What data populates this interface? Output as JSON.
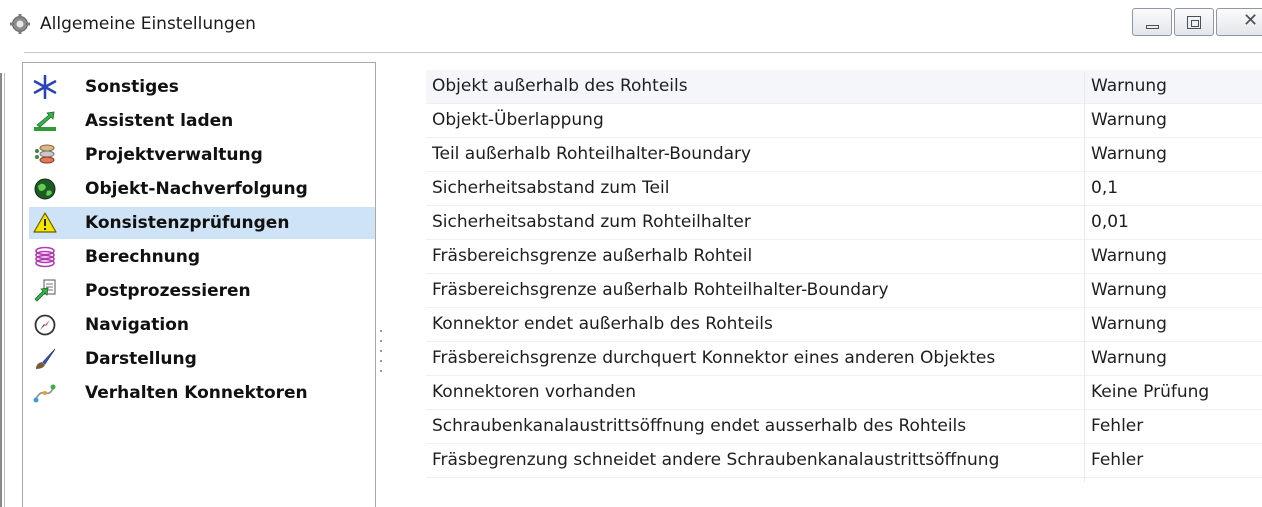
{
  "window": {
    "title": "Allgemeine Einstellungen",
    "icon": "gear-icon",
    "controls": [
      "minimize-icon",
      "maximize-icon",
      "close-icon"
    ]
  },
  "sidebar": {
    "selected_index": 4,
    "selected_color": "#cfe3f7",
    "items": [
      {
        "label": "Sonstiges",
        "icon": "asterisk-icon"
      },
      {
        "label": "Assistent laden",
        "icon": "load-arrow-icon"
      },
      {
        "label": "Projektverwaltung",
        "icon": "stack-icon"
      },
      {
        "label": "Objekt-Nachverfolgung",
        "icon": "globe-icon"
      },
      {
        "label": "Konsistenzprüfungen",
        "icon": "warning-icon"
      },
      {
        "label": "Berechnung",
        "icon": "spiral-icon"
      },
      {
        "label": "Postprozessieren",
        "icon": "export-icon"
      },
      {
        "label": "Navigation",
        "icon": "compass-icon"
      },
      {
        "label": "Darstellung",
        "icon": "brush-icon"
      },
      {
        "label": "Verhalten Konnektoren",
        "icon": "connector-icon"
      }
    ]
  },
  "properties": {
    "rows": [
      {
        "name": "Objekt außerhalb des Rohteils",
        "value": "Warnung"
      },
      {
        "name": "Objekt-Überlappung",
        "value": "Warnung"
      },
      {
        "name": "Teil außerhalb Rohteilhalter-Boundary",
        "value": "Warnung"
      },
      {
        "name": "Sicherheitsabstand zum Teil",
        "value": "0,1"
      },
      {
        "name": "Sicherheitsabstand zum Rohteilhalter",
        "value": "0,01"
      },
      {
        "name": "Fräsbereichsgrenze außerhalb Rohteil",
        "value": "Warnung"
      },
      {
        "name": "Fräsbereichsgrenze außerhalb Rohteilhalter-Boundary",
        "value": "Warnung"
      },
      {
        "name": "Konnektor endet außerhalb des Rohteils",
        "value": "Warnung"
      },
      {
        "name": "Fräsbereichsgrenze durchquert Konnektor eines anderen Objektes",
        "value": "Warnung"
      },
      {
        "name": "Konnektoren vorhanden",
        "value": "Keine Prüfung"
      },
      {
        "name": "Schraubenkanalaustrittsöffnung endet ausserhalb des Rohteils",
        "value": "Fehler"
      },
      {
        "name": "Fräsbegrenzung schneidet andere Schraubenkanalaustrittsöffnung",
        "value": "Fehler"
      }
    ]
  }
}
